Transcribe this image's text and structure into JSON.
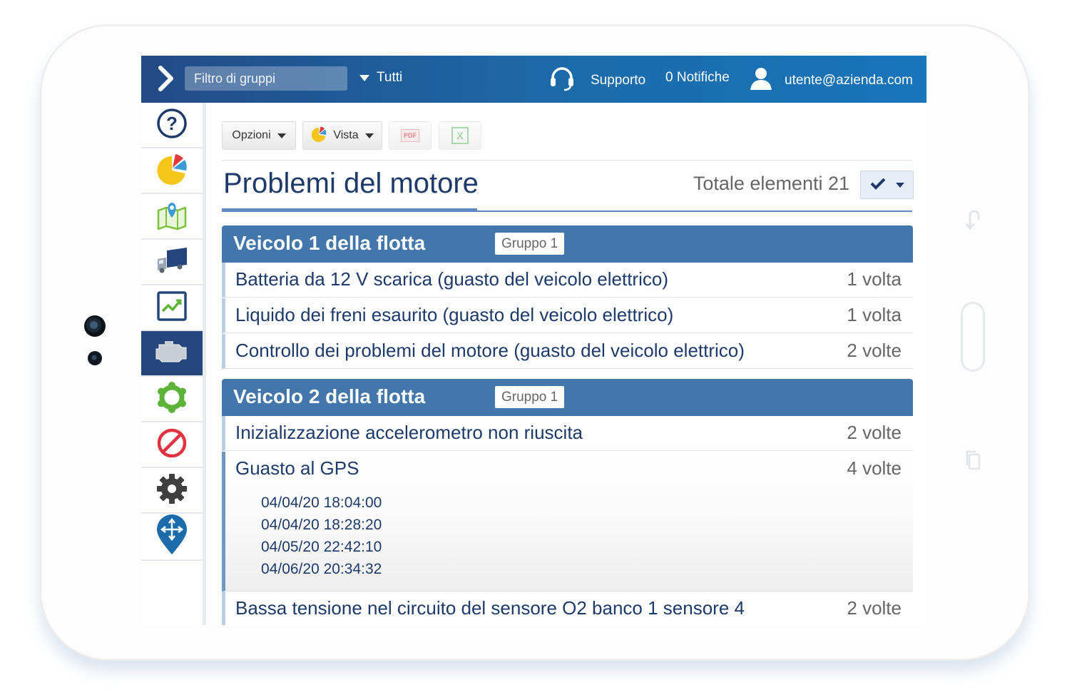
{
  "header": {
    "filter_placeholder": "Filtro di gruppi",
    "scope": "Tutti",
    "support": "Supporto",
    "notifications": "0 Notifiche",
    "user": "utente@azienda.com"
  },
  "sidebar": {
    "items": [
      {
        "name": "help-icon"
      },
      {
        "name": "pie-chart-icon"
      },
      {
        "name": "map-pin-icon"
      },
      {
        "name": "truck-icon"
      },
      {
        "name": "trend-chart-icon"
      },
      {
        "name": "engine-icon",
        "active": true
      },
      {
        "name": "gear-outline-icon"
      },
      {
        "name": "prohibited-icon"
      },
      {
        "name": "settings-gear-icon"
      },
      {
        "name": "location-move-icon"
      }
    ]
  },
  "toolbar": {
    "options_label": "Opzioni",
    "view_label": "Vista",
    "pdf_label": "PDF",
    "excel_label": "X"
  },
  "page": {
    "title": "Problemi del motore",
    "total": "Totale elementi 21"
  },
  "groups": [
    {
      "name": "Veicolo 1 della flotta",
      "badge": "Gruppo 1",
      "rows": [
        {
          "text": "Batteria da 12 V scarica (guasto del veicolo elettrico)",
          "count": "1 volta"
        },
        {
          "text": "Liquido dei freni esaurito (guasto del veicolo elettrico)",
          "count": "1 volta"
        },
        {
          "text": "Controllo dei problemi del motore (guasto del veicolo elettrico)",
          "count": "2 volte"
        }
      ]
    },
    {
      "name": "Veicolo 2 della flotta",
      "badge": "Gruppo 1",
      "rows": [
        {
          "text": "Inizializzazione accelerometro non riuscita",
          "count": "2 volte"
        },
        {
          "text": "Guasto al GPS",
          "count": "4 volte",
          "timestamps": [
            "04/04/20 18:04:00",
            "04/04/20 18:28:20",
            "04/05/20 22:42:10",
            "04/06/20 20:34:32"
          ]
        },
        {
          "text": "Bassa tensione nel circuito del sensore O2 banco 1 sensore 4",
          "count": "2 volte"
        }
      ]
    }
  ],
  "colors": {
    "header_start": "#234b86",
    "header_end": "#1775b8",
    "group_header": "#4377ac",
    "title_text": "#1e3a6a",
    "active_sidebar": "#24467c"
  }
}
